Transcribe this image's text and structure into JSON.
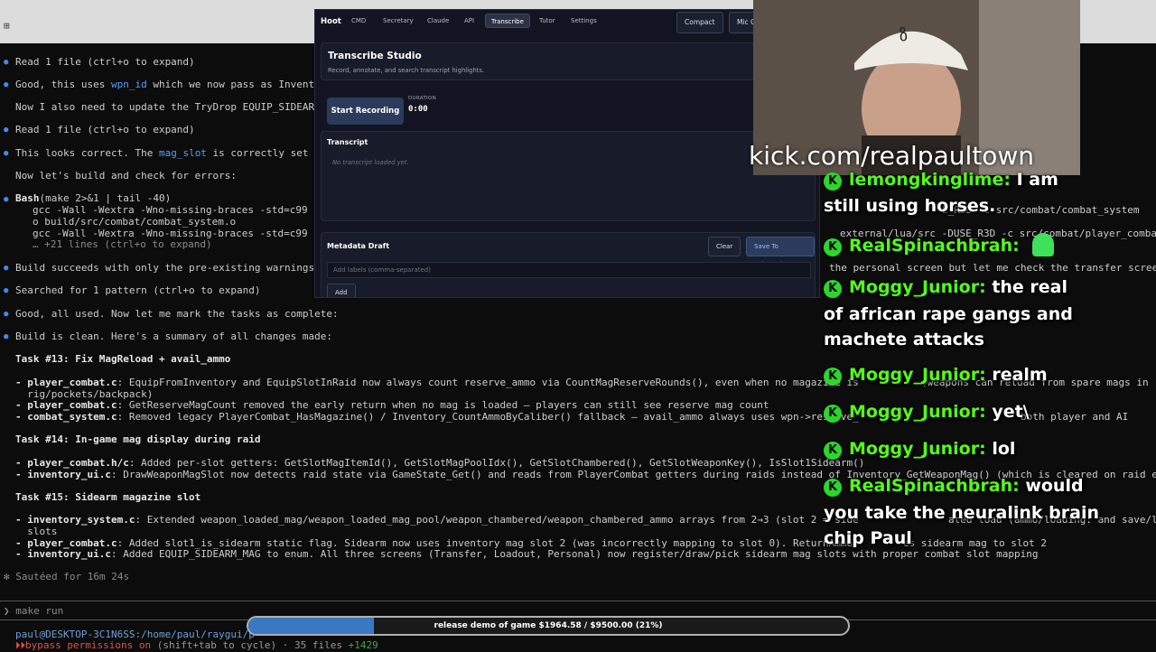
{
  "window": {
    "glyph": "⊞"
  },
  "terminal": {
    "l1": "Read 1 file (ctrl+o to expand)",
    "l2a": "Good, this uses ",
    "l2b": "wpn_id",
    "l2c": " which we now pass as Inventor",
    "l3": "Now I also need to update the TryDrop EQUIP_SIDEARM_",
    "l4": "Read 1 file (ctrl+o to expand)",
    "l5a": "This looks correct. The ",
    "l5b": "mag_slot",
    "l5c": " is correctly set to",
    "l6": "Now let's build and check for errors:",
    "l7a": "Bash",
    "l7b": "(make 2>&1 | tail -40)",
    "l8": "gcc -Wall -Wextra -Wno-missing-braces -std=c99 -O",
    "l9": "o build/src/combat/combat_system.o",
    "l10": "gcc -Wall -Wextra -Wno-missing-braces -std=c99 -O",
    "l11": "… +21 lines (ctrl+o to expand)",
    "l12": "Build succeeds with only the pre-existing warnings.",
    "l13": "Searched for 1 pattern (ctrl+o to expand)",
    "l14": "Good, all used. Now let me mark the tasks as complete:",
    "l15": "Build is clean. Here's a summary of all changes made:",
    "t13": "Task #13: Fix MagReload + avail_ammo",
    "t13a1": "- player_combat.c",
    "t13a2": ": EquipFromInventory and EquipSlotInRaid now always count reserve_ammo via CountMagReserveRounds(), even when no magazine is",
    "t13a3": "  rig/pockets/backpack)",
    "t13b1": "- player_combat.c",
    "t13b2": ": GetReserveMagCount removed the early return when no mag is loaded — players can still see reserve mag count",
    "t13c1": "- combat_system.c",
    "t13c2": ": Removed legacy PlayerCombat_HasMagazine() / Inventory_CountAmmoByCaliber() fallback — avail_ammo always uses wpn->reserve_",
    "t14": "Task #14: In-game mag display during raid",
    "t14a1": "- player_combat.h/c",
    "t14a2": ": Added per-slot getters: GetSlotMagItemId(), GetSlotMagPoolIdx(), GetSlotChambered(), GetSlotWeaponKey(), IsSlot1Sidearm()",
    "t14b1": "- inventory_ui.c",
    "t14b2": ": DrawWeaponMagSlot now detects raid state via GameState_Get() and reads from PlayerCombat getters during raids instead of Inventory_GetWeaponMag() (which is cleared on raid entry)",
    "t15": "Task #15: Sidearm magazine slot",
    "t15a1": "- inventory_system.c",
    "t15a2": ": Extended weapon_loaded_mag/weapon_loaded_mag_pool/weapon_chambered/weapon_chambered_ammo arrays from 2→3 (slot 2 = side",
    "t15a3": "  slots",
    "t15b1": "- player_combat.c",
    "t15b2": ": Added slot1_is_sidearm static flag. Sidearm now uses inventory mag slot 2 (was incorrectly mapping to slot 0). ReturnAmmoT",
    "t15b3": "es sidearm mag to slot 2",
    "t15c1": "- inventory_ui.c",
    "t15c2": ": Added EQUIP_SIDEARM_MAG to enum. All three screens (Transfer, Loadout, Personal) now register/draw/pick sidearm mag slots with proper combat slot mapping",
    "saute": "✻ Sautéed for 16m 24s",
    "prompt": "❯ make run",
    "path": "paul@DESKTOP-3C1N6SS:/home/paul/raygui/p",
    "status1": "⏵⏵bypass permissions on",
    "status2": " (shift+tab to cycle) · 35 files ",
    "status3": "+1429",
    "r1": "E_R3D -c src/combat/combat_system",
    "r2": "external/lua/src -DUSE_R3D -c src/combat/player_combat",
    "r3": "the personal screen but let me check the transfer screen:",
    "r4": "(weapons can reload from spare mags in",
    "r5": "both player and AI",
    "r6": "ated load (ammo/loading: and save/load to",
    "r7": "eturns"
  },
  "hoot": {
    "brand": "Hoot",
    "tabs": [
      "CMD",
      "Secretary",
      "Claude",
      "API",
      "Transcribe",
      "Tutor",
      "Settings"
    ],
    "active_tab": "Transcribe",
    "compact": "Compact",
    "mic": "Mic C",
    "title": "Transcribe Studio",
    "subtitle": "Record, annotate, and search transcript highlights.",
    "record_btn": "Start Recording",
    "duration_label": "DURATION",
    "duration": "0:00",
    "transcript_label": "Transcript",
    "transcript_empty": "No transcript loaded yet.",
    "metadata_label": "Metadata Draft",
    "clear_btn": "Clear",
    "save_btn": "Save To Selected",
    "labels_placeholder": "Add labels (comma-separated)",
    "add_btn": "Add"
  },
  "stream": {
    "url": "kick.com/realpaultown",
    "chat": [
      {
        "user": "lemongkinglime:",
        "text": " I am",
        "cont": [
          "still using horses."
        ]
      },
      {
        "user": "RealSpinachbrah:",
        "text": " ",
        "cont": []
      },
      {
        "user": "Moggy_Junior:",
        "text": " the real",
        "cont": [
          "of african rape gangs and",
          "machete attacks"
        ]
      },
      {
        "user": "Moggy_Junior:",
        "text": " realm",
        "cont": []
      },
      {
        "user": "Moggy_Junior:",
        "text": " yet\\",
        "cont": []
      },
      {
        "user": "Moggy_Junior:",
        "text": " lol",
        "cont": []
      },
      {
        "user": "RealSpinachbrah:",
        "text": " would",
        "cont": [
          "you take the neuralink brain",
          "chip Paul"
        ]
      }
    ],
    "goal_text": "release demo of game $1964.58 / $9500.00 (21%)",
    "goal_fraction": 0.21
  },
  "colors": {
    "kick_green": "#53fc18",
    "goal_fill": "#3a78c4",
    "accent_blue": "#3b8eea"
  }
}
